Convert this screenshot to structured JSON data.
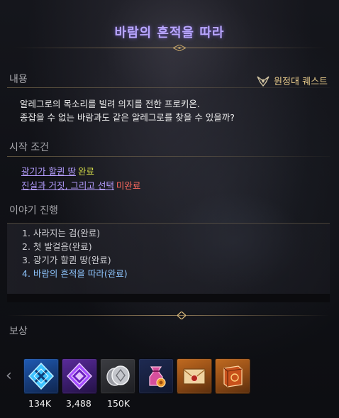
{
  "title": "바람의 흔적을 따라",
  "quest_type": {
    "label": "원정대 퀘스트",
    "icon": "guild-quest-icon"
  },
  "sections": {
    "content": {
      "label": "내용",
      "lines": [
        "알레그로의 목소리를 빌려 의지를 전한 프로키온.",
        "종잡을 수 없는 바람과도 같은 알레그로를 찾을 수 있을까?"
      ]
    },
    "start_conditions": {
      "label": "시작 조건",
      "items": [
        {
          "name": "광기가 할퀸 땅",
          "status": "완료",
          "status_color": "#d7e04a"
        },
        {
          "name": "진실과 거짓, 그리고 선택",
          "status": "미완료",
          "status_color": "#ff6a5f"
        }
      ]
    },
    "story": {
      "label": "이야기 진행",
      "items": [
        "1. 사라지는 검(완료)",
        "2. 첫 발걸음(완료)",
        "3. 광기가 할퀸 땅(완료)",
        "4. 바람의 흔적을 따라(완료)"
      ]
    },
    "rewards": {
      "label": "보상",
      "items": [
        {
          "icon": "blue-crystal-icon",
          "grade": "blue",
          "count": "134K"
        },
        {
          "icon": "purple-crystal-icon",
          "grade": "purple",
          "count": "3,488"
        },
        {
          "icon": "silver-coins-icon",
          "grade": "gray",
          "count": "150K"
        },
        {
          "icon": "pouch-icon",
          "grade": "navy",
          "count": ""
        },
        {
          "icon": "sealed-letter-icon",
          "grade": "orange",
          "count": ""
        },
        {
          "icon": "book-icon",
          "grade": "orange",
          "count": ""
        }
      ]
    }
  },
  "colors": {
    "title": "#b9a6ff",
    "accent_gold": "#e6c98a",
    "link_purple": "#b49dff",
    "current_step_blue": "#8fc6ff"
  }
}
